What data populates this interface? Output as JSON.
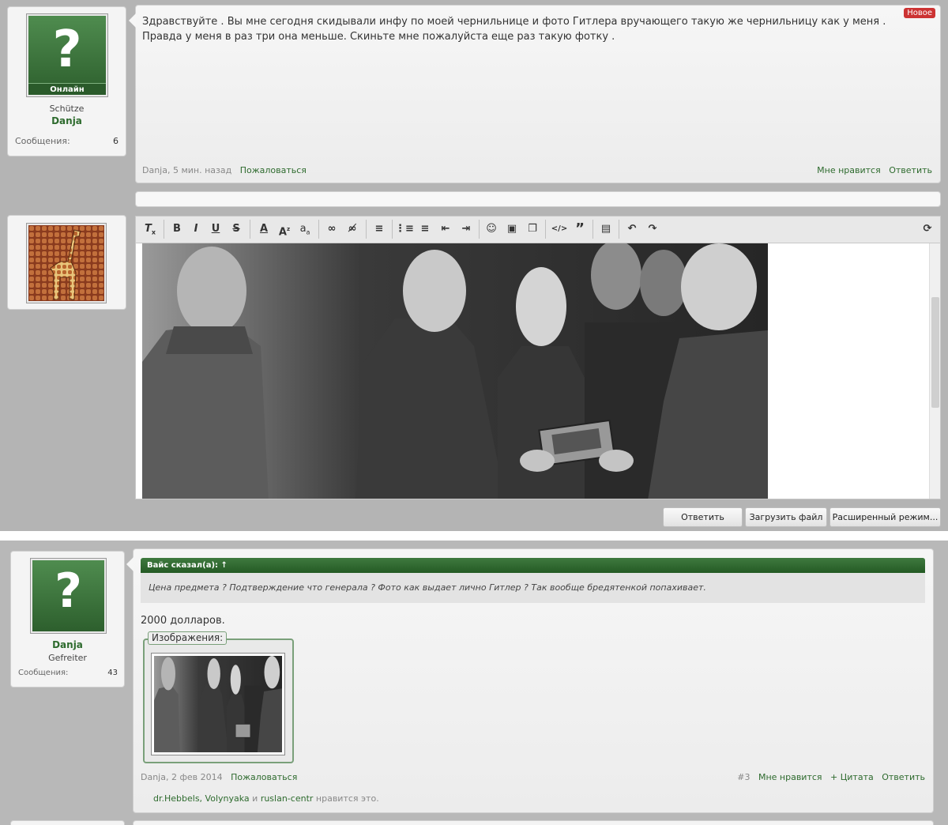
{
  "post1": {
    "badge_new": "Новое",
    "user": {
      "status": "Онлайн",
      "rank": "Schütze",
      "name": "Danja",
      "messages_label": "Сообщения:",
      "messages_count": "6"
    },
    "text_line1": "Здравствуйте . Вы мне сегодня скидывали инфу по моей чернильнице и фото Гитлера вручающего такую же чернильницу как у меня .",
    "text_line2": "Правда у меня в раз три она меньше. Скиньте мне пожалуйста еще раз такую фотку .",
    "meta_author": "Danja, 5 мин. назад",
    "report": "Пожаловаться",
    "like": "Мне нравится",
    "reply": "Ответить"
  },
  "editor": {
    "toolbar": [
      "remove-format",
      "bold",
      "italic",
      "underline",
      "strikethrough",
      "font-color",
      "font-size",
      "font-family",
      "link",
      "unlink",
      "align",
      "bullet-list",
      "number-list",
      "outdent",
      "indent",
      "smiley",
      "image",
      "media",
      "code",
      "quote",
      "draft",
      "undo",
      "redo",
      "toggle-mode"
    ],
    "buttons": {
      "reply": "Ответить",
      "upload": "Загрузить файл",
      "advanced": "Расширенный режим..."
    }
  },
  "post3": {
    "user": {
      "name": "Danja",
      "rank": "Gefreiter",
      "messages_label": "Сообщения:",
      "messages_count": "43"
    },
    "quote_author": "Вайс сказал(а): ↑",
    "quote_text": "Цена предмета ? Подтверждение что генерала ? Фото как выдает лично Гитлер ? Так вообще бредятенкой попахивает.",
    "body": "2000 долларов.",
    "attachments_label": "Изображения:",
    "meta_author": "Danja, 2 фев 2014",
    "report": "Пожаловаться",
    "post_number": "#3",
    "like": "Мне нравится",
    "quote_btn": "+ Цитата",
    "reply": "Ответить",
    "likes_users": "dr.Hebbels, Volynyaka",
    "likes_and": "и",
    "likes_user3": "ruslan-centr",
    "likes_suffix": "нравится это."
  },
  "colors": {
    "accent": "#2e6b2e",
    "badge": "#cc3333",
    "panel": "#b4b4b4"
  }
}
